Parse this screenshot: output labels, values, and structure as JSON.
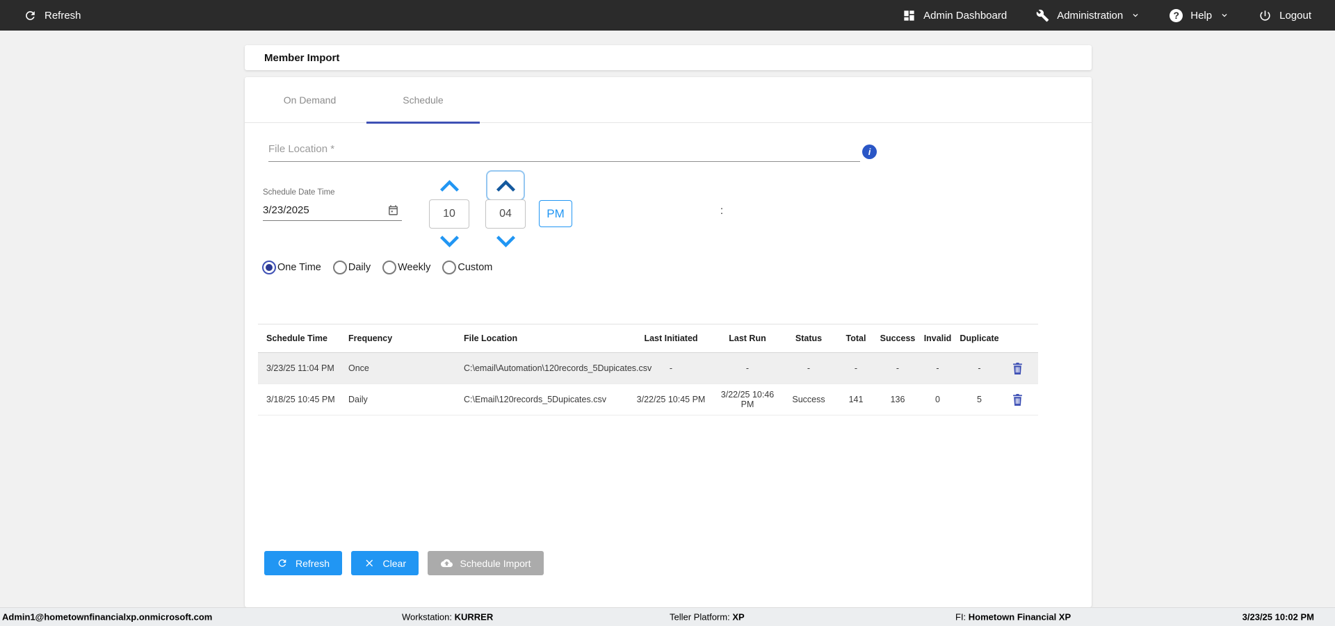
{
  "topbar": {
    "refresh": "Refresh",
    "admin_dashboard": "Admin Dashboard",
    "administration": "Administration",
    "help": "Help",
    "logout": "Logout"
  },
  "page": {
    "title": "Member Import"
  },
  "tabs": {
    "on_demand": "On Demand",
    "schedule": "Schedule",
    "active": "Schedule"
  },
  "form": {
    "file_location_placeholder": "File Location *",
    "info_icon_glyph": "i",
    "schedule_date_time_label": "Schedule Date Time",
    "date_value": "3/23/2025",
    "hour": "10",
    "time_separator": ":",
    "minute": "04",
    "meridiem": "PM",
    "frequency_options": [
      "One Time",
      "Daily",
      "Weekly",
      "Custom"
    ],
    "frequency_selected": "One Time"
  },
  "table": {
    "headers": [
      "Schedule Time",
      "Frequency",
      "File Location",
      "Last Initiated",
      "Last Run",
      "Status",
      "Total",
      "Success",
      "Invalid",
      "Duplicate"
    ],
    "rows": [
      {
        "schedule_time": "3/23/25 11:04 PM",
        "frequency": "Once",
        "file_location": "C:\\email\\Automation\\120records_5Dupicates.csv",
        "last_initiated": "-",
        "last_run": "-",
        "status": "-",
        "total": "-",
        "success": "-",
        "invalid": "-",
        "duplicate": "-",
        "selected": true
      },
      {
        "schedule_time": "3/18/25 10:45 PM",
        "frequency": "Daily",
        "file_location": "C:\\Email\\120records_5Dupicates.csv",
        "last_initiated": "3/22/25 10:45 PM",
        "last_run": "3/22/25 10:46 PM",
        "status": "Success",
        "total": "141",
        "success": "136",
        "invalid": "0",
        "duplicate": "5",
        "selected": false
      }
    ]
  },
  "actions": {
    "refresh": "Refresh",
    "clear": "Clear",
    "schedule_import": "Schedule Import"
  },
  "footer": {
    "user": "Admin1@hometownfinancialxp.onmicrosoft.com",
    "workstation_label": "Workstation: ",
    "workstation_value": "KURRER",
    "teller_platform_label": "Teller Platform: ",
    "teller_platform_value": "XP",
    "fi_label": "FI: ",
    "fi_value": "Hometown Financial XP",
    "timestamp": "3/23/25 10:02 PM"
  },
  "colors": {
    "topbar_bg": "#2b2b2b",
    "accent_blue": "#2196f3",
    "indigo_accent": "#3f51b5",
    "info_blue": "#2a56c6",
    "selected_row_bg": "#efefef",
    "disabled_button": "#ababab"
  }
}
